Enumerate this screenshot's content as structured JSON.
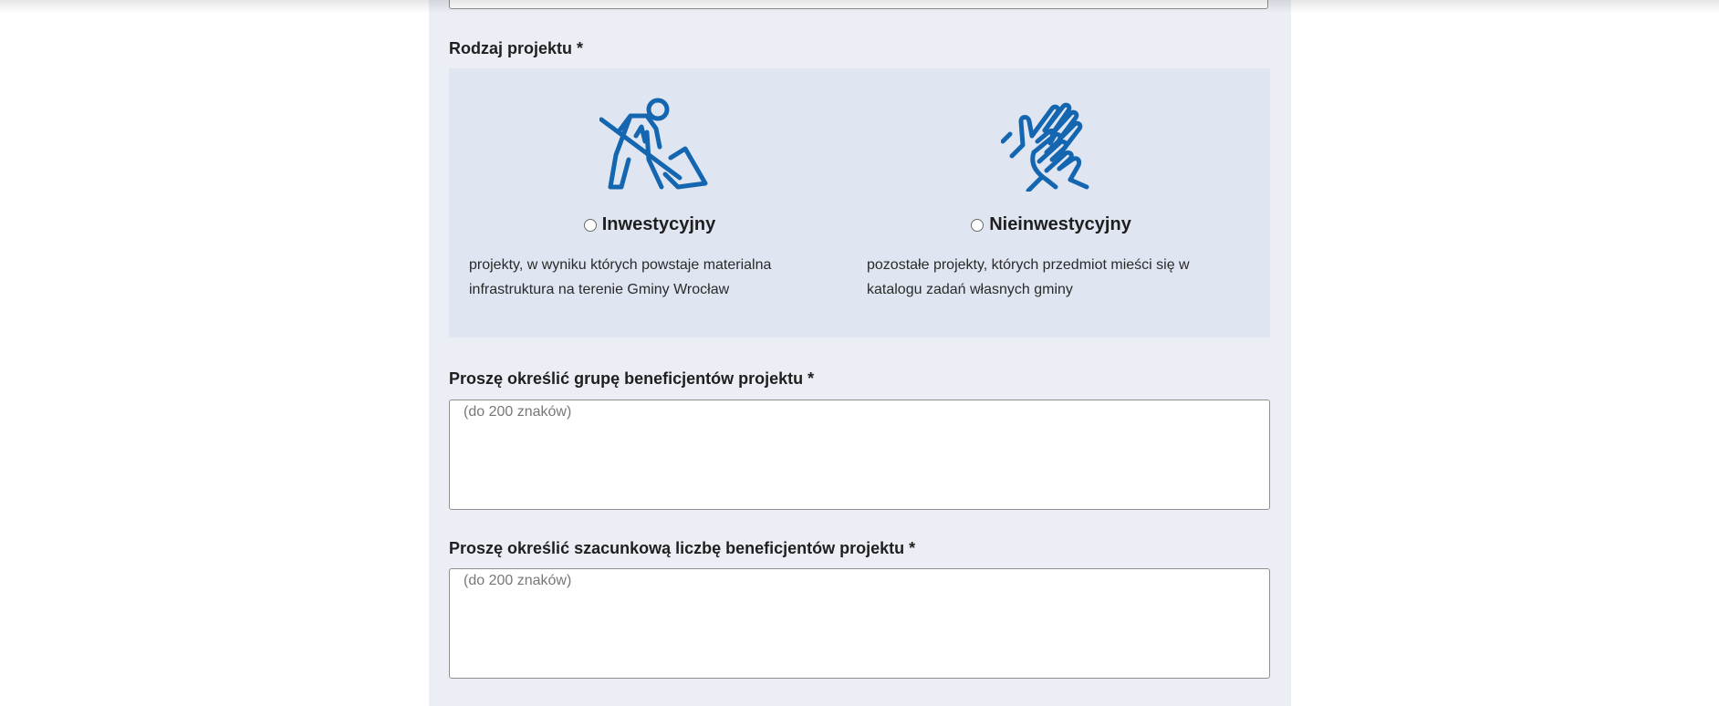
{
  "form": {
    "project_type": {
      "label": "Rodzaj projektu *",
      "options": [
        {
          "title": "Inwestycyjny",
          "icon": "construction-worker-icon",
          "description_line1": "projekty, w wyniku których powstaje materialna",
          "description_line2": "infrastruktura na terenie Gminy Wrocław"
        },
        {
          "title": "Nieinwestycyjny",
          "icon": "clapping-hands-icon",
          "description_line1": "pozostałe projekty, których przedmiot mieści się w",
          "description_line2": "katalogu zadań własnych gminy"
        }
      ]
    },
    "beneficiary_group": {
      "label": "Proszę określić grupę beneficjentów projektu *",
      "placeholder": "(do 200 znaków)",
      "value": ""
    },
    "beneficiary_count": {
      "label": "Proszę określić szacunkową liczbę beneficjentów projektu *",
      "placeholder": "(do 200 znaków)",
      "value": ""
    }
  },
  "colors": {
    "panel_background": "#ebeff5",
    "choice_background": "#dfe6f1",
    "icon_blue": "#1466b0"
  }
}
